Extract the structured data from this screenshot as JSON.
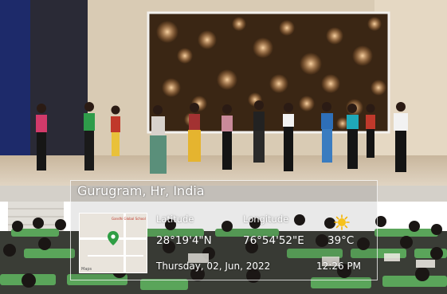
{
  "geo_tag": {
    "location": "Gurugram, Hr, India",
    "latitude_label": "Latitude",
    "latitude_value": "28°19'4\"N",
    "longitude_label": "Longitude",
    "longitude_value": "76°54'52\"E",
    "temperature": "39°C",
    "weather_icon": "sun-icon",
    "date": "Thursday, 02, Jun, 2022",
    "time": "12:26 PM",
    "map_poi_label": "Gandhi Global School",
    "map_brand": "Maps"
  },
  "colors": {
    "stage_floor": "#d8c9b2",
    "screen_glow": "#e8934a",
    "seat_green": "#5aa55a"
  }
}
